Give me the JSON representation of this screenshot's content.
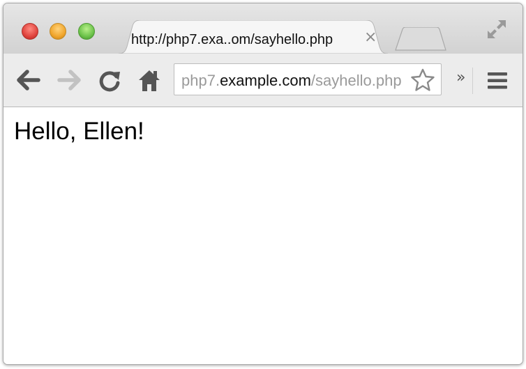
{
  "tab": {
    "title": "http://php7.exa..om/sayhello.php",
    "close_glyph": "×"
  },
  "toolbar": {
    "url_prefix": "php7.",
    "url_host": "example.com",
    "url_path": "/sayhello.php",
    "extensions_glyph": "»"
  },
  "page": {
    "greeting": "Hello, Ellen!"
  },
  "icons": [
    "back-arrow-icon",
    "forward-arrow-icon",
    "reload-icon",
    "home-icon",
    "star-icon",
    "menu-icon",
    "fullscreen-icon"
  ],
  "colors": {
    "close": "#e0443e",
    "minimize": "#f0a52c",
    "zoom": "#6cc24a",
    "dim_url": "#9a9a9a"
  }
}
